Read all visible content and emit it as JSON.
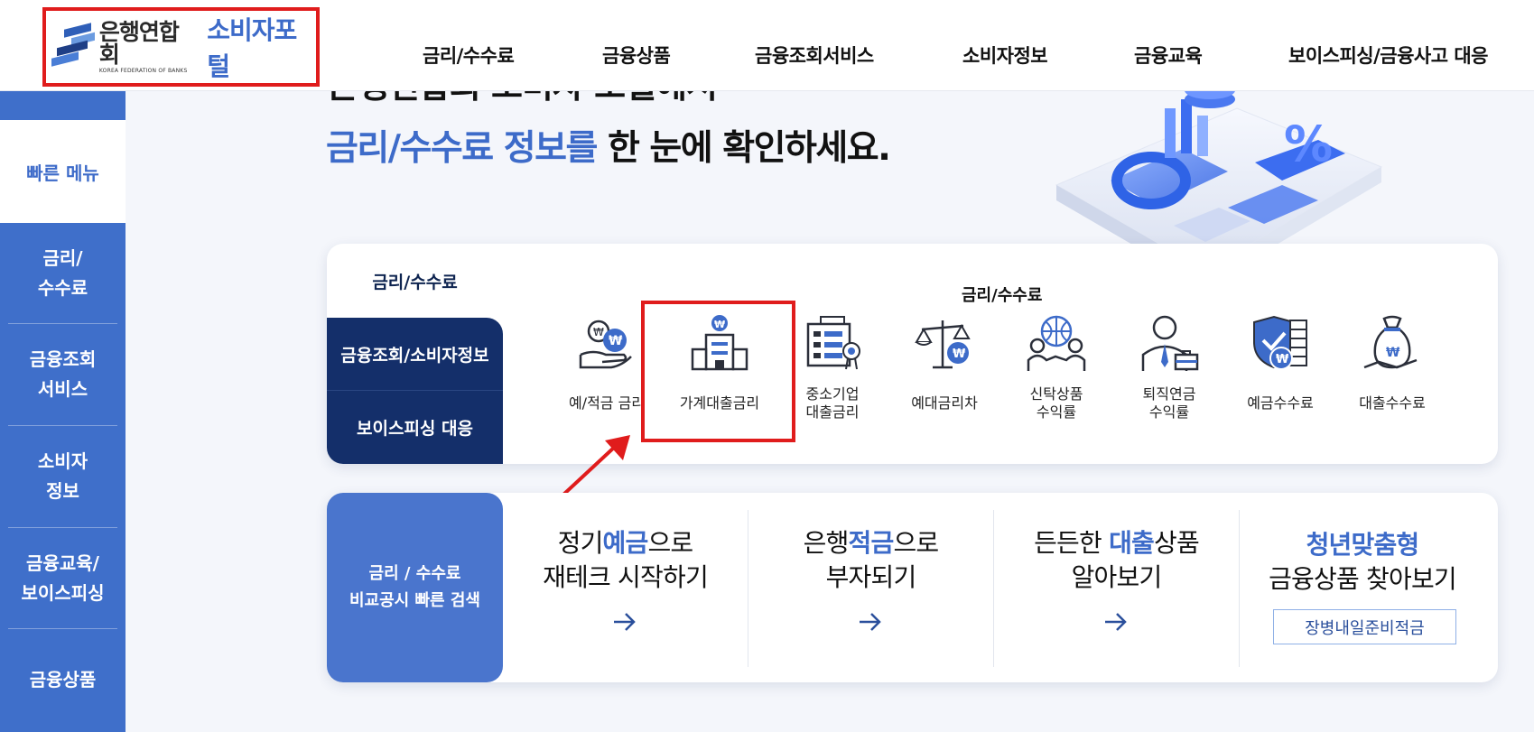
{
  "header": {
    "logo_kr": "은행연합회",
    "logo_en": "KOREA FEDERATION OF BANKS",
    "portal": "소비자포털",
    "nav": [
      "금리/수수료",
      "금융상품",
      "금융조회서비스",
      "소비자정보",
      "금융교육",
      "보이스피싱/금융사고 대응"
    ]
  },
  "sidebar": {
    "quick_label": "빠른 메뉴",
    "items": [
      "금리/\n수수료",
      "금융조회\n서비스",
      "소비자\n정보",
      "금융교육/\n보이스피싱",
      "금융상품"
    ]
  },
  "hero": {
    "line1_partial": "은행연합회 소비자 포털에서",
    "line2_highlight": "금리/수수료 정보를",
    "line2_rest": " 한 눈에 확인하세요."
  },
  "panel": {
    "tabs": [
      "금리/수수료",
      "금융조회/소비자정보",
      "보이스피싱 대응"
    ],
    "sub_title": "금리/수수료",
    "menu": [
      {
        "label": "예/적금 금리",
        "icon": "deposit-coin-icon"
      },
      {
        "label": "가계대출금리",
        "icon": "bank-building-icon"
      },
      {
        "label": "중소기업\n대출금리",
        "icon": "factory-icon"
      },
      {
        "label": "예대금리차",
        "icon": "scale-icon"
      },
      {
        "label": "신탁상품\n수익률",
        "icon": "globe-handshake-icon"
      },
      {
        "label": "퇴직연금\n수익률",
        "icon": "businessman-icon"
      },
      {
        "label": "예금수수료",
        "icon": "shield-coin-icon"
      },
      {
        "label": "대출수수료",
        "icon": "money-bag-icon"
      }
    ]
  },
  "quick_search": {
    "title": "금리 / 수수료\n비교공시 빠른 검색",
    "cards": [
      {
        "l1_a": "정기",
        "l1_accent": "예금",
        "l1_b": "으로",
        "l2": "재테크 시작하기"
      },
      {
        "l1_a": "은행",
        "l1_accent": "적금",
        "l1_b": "으로",
        "l2": "부자되기"
      },
      {
        "l1_a": "든든한 ",
        "l1_accent": "대출",
        "l1_b": "상품",
        "l2": "알아보기"
      },
      {
        "l1_a": "",
        "l1_accent": "청년맞춤형",
        "l1_b": "",
        "l2": "금융상품 찾아보기",
        "button": "장병내일준비적금"
      }
    ]
  },
  "colors": {
    "brand_blue": "#3d6bc9",
    "navy": "#142f6a",
    "highlight_red": "#e01c1c"
  }
}
